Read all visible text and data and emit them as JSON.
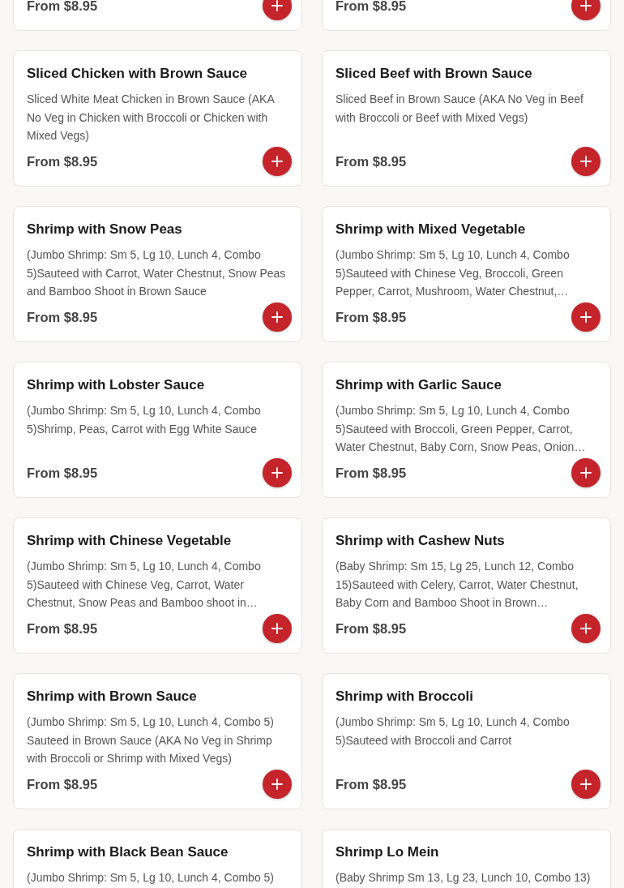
{
  "items": [
    {
      "kind": "partial",
      "price": "From $8.95"
    },
    {
      "kind": "partial",
      "price": "From $8.95"
    },
    {
      "kind": "full",
      "name": "Sliced Chicken with Brown Sauce",
      "description": "Sliced White Meat Chicken in Brown Sauce (AKA No Veg in Chicken with Broccoli or Chicken with Mixed Vegs)",
      "price": "From $8.95"
    },
    {
      "kind": "full",
      "name": "Sliced Beef with Brown Sauce",
      "description": "Sliced Beef in Brown Sauce (AKA No Veg in Beef with Broccoli or Beef with Mixed Vegs)",
      "price": "From $8.95"
    },
    {
      "kind": "full",
      "name": "Shrimp with Snow Peas",
      "description": "(Jumbo Shrimp: Sm 5, Lg 10, Lunch 4, Combo 5)Sauteed with Carrot, Water Chestnut, Snow Peas and Bamboo Shoot in Brown Sauce",
      "price": "From $8.95"
    },
    {
      "kind": "full",
      "name": "Shrimp with Mixed Vegetable",
      "description": "(Jumbo Shrimp: Sm 5, Lg 10, Lunch 4, Combo 5)Sauteed with Chinese Veg, Broccoli, Green Pepper, Carrot, Mushroom, Water Chestnut,…",
      "price": "From $8.95"
    },
    {
      "kind": "full",
      "name": "Shrimp with Lobster Sauce",
      "description": "(Jumbo Shrimp: Sm 5, Lg 10, Lunch 4, Combo 5)Shrimp, Peas, Carrot with Egg White Sauce",
      "price": "From $8.95"
    },
    {
      "kind": "full",
      "name": "Shrimp with Garlic Sauce",
      "description": "(Jumbo Shrimp: Sm 5, Lg 10, Lunch 4, Combo 5)Sauteed with Broccoli, Green Pepper, Carrot, Water Chestnut, Baby Corn, Snow Peas, Onion…",
      "price": "From $8.95"
    },
    {
      "kind": "full",
      "name": "Shrimp with Chinese Vegetable",
      "description": "(Jumbo Shrimp: Sm 5, Lg 10, Lunch 4, Combo 5)Sauteed with Chinese Veg, Carrot, Water Chestnut, Snow Peas and Bamboo shoot in…",
      "price": "From $8.95"
    },
    {
      "kind": "full",
      "name": "Shrimp with Cashew Nuts",
      "description": "(Baby Shrimp: Sm 15, Lg 25, Lunch 12, Combo 15)Sauteed with Celery, Carrot, Water Chestnut, Baby Corn and Bamboo Shoot in Brown…",
      "price": "From $8.95"
    },
    {
      "kind": "full",
      "name": "Shrimp with Brown Sauce",
      "description": "(Jumbo Shrimp: Sm 5, Lg 10, Lunch 4, Combo 5) Sauteed in Brown Sauce (AKA No Veg in Shrimp with Broccoli or Shrimp with Mixed Vegs)",
      "price": "From $8.95"
    },
    {
      "kind": "full",
      "name": "Shrimp with Broccoli",
      "description": "(Jumbo Shrimp: Sm 5, Lg 10, Lunch 4, Combo 5)Sauteed with Broccoli and Carrot",
      "price": "From $8.95"
    },
    {
      "kind": "cut",
      "name": "Shrimp with Black Bean Sauce",
      "description": "(Jumbo Shrimp: Sm 5, Lg 10, Lunch 4, Combo 5)"
    },
    {
      "kind": "cut",
      "name": "Shrimp Lo Mein",
      "description": "(Baby Shrimp Sm 13, Lg 23, Lunch 10, Combo 13)"
    }
  ]
}
